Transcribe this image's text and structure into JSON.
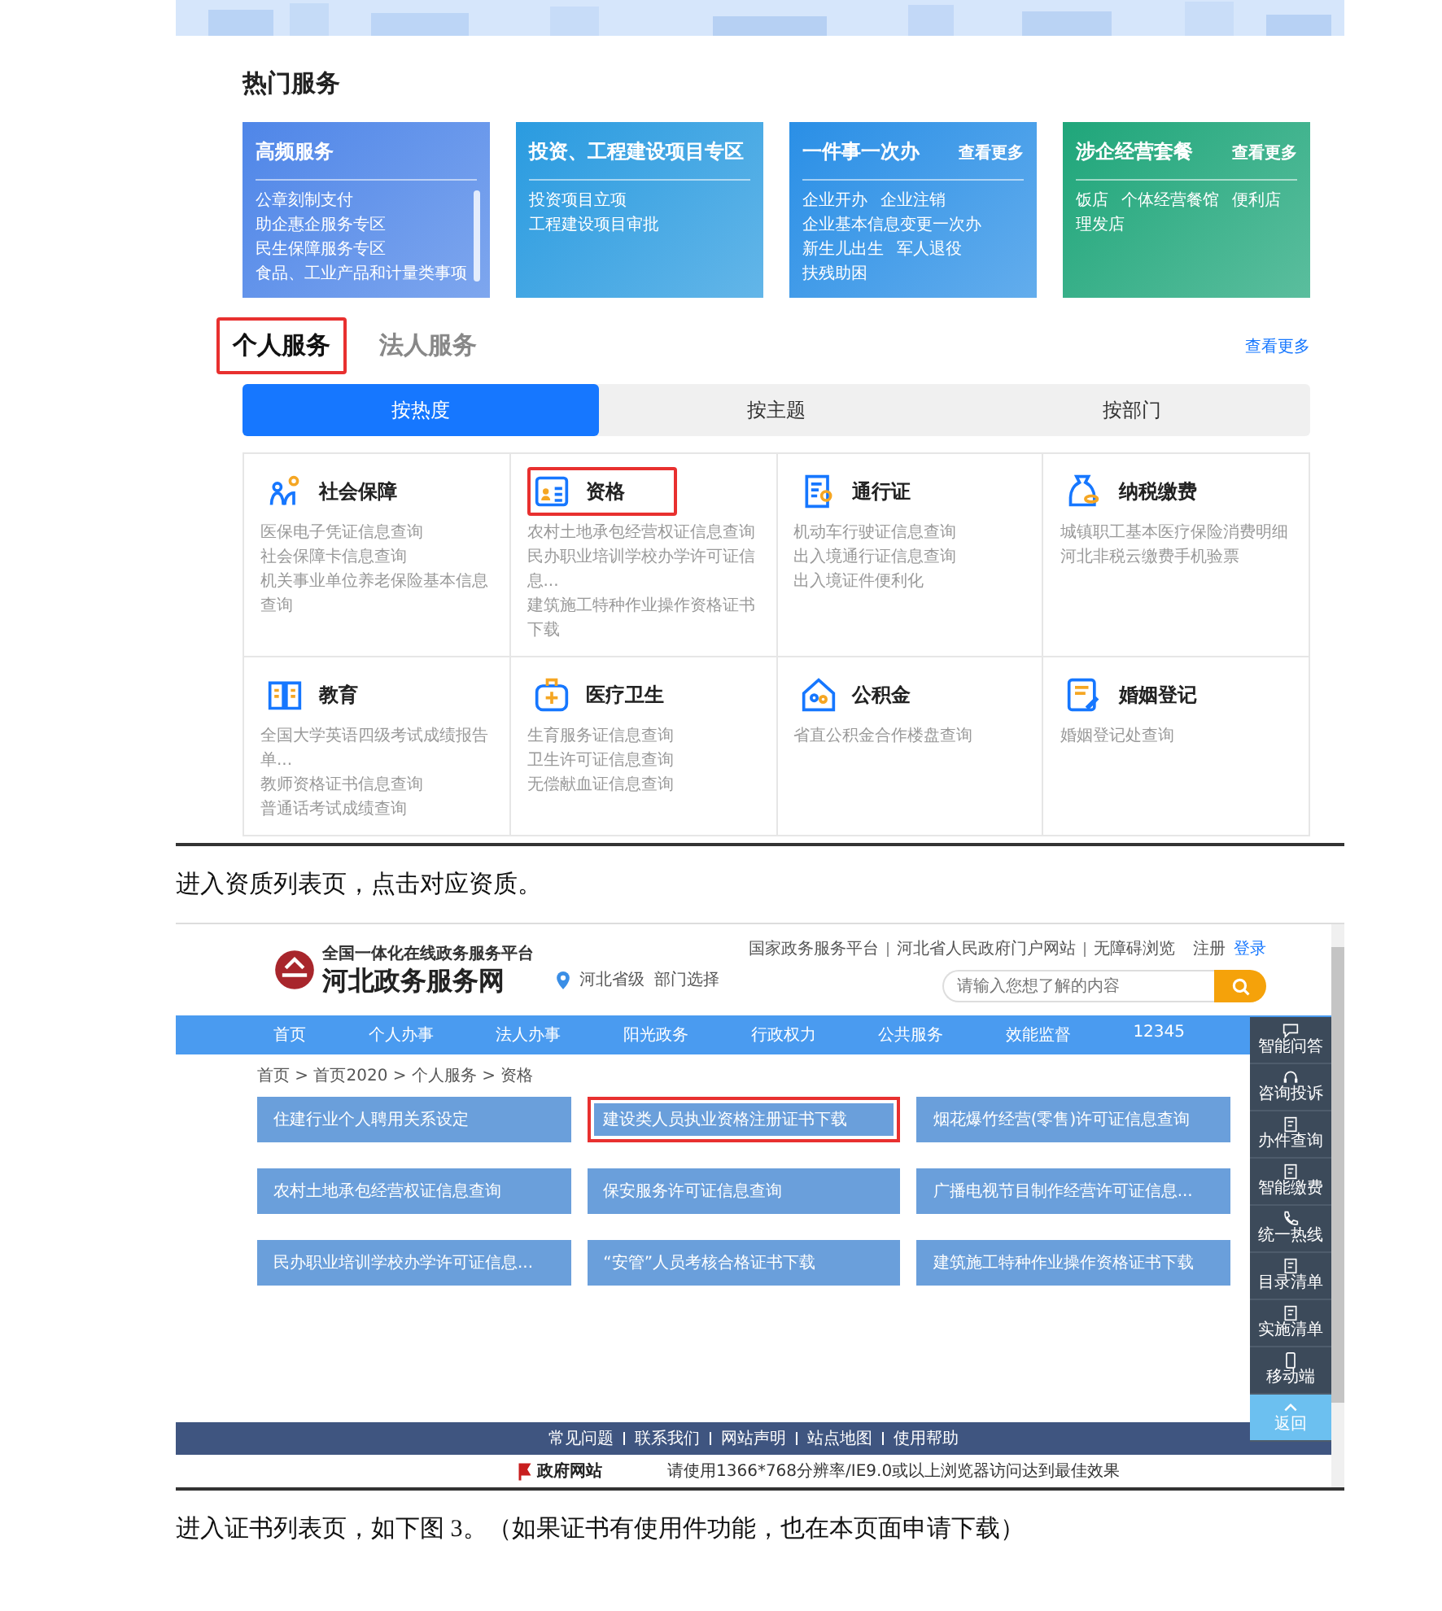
{
  "hot_services": {
    "title": "热门服务",
    "cards": [
      {
        "title": "高频服务",
        "color": "#4f86e8",
        "scroll": true,
        "lines": [
          [
            "公章刻制支付"
          ],
          [
            "助企惠企服务专区"
          ],
          [
            "民生保障服务专区"
          ],
          [
            "食品、工业产品和计量类事项"
          ]
        ]
      },
      {
        "title": "投资、工程建设项目专区",
        "color": "#2a9be0",
        "scroll": false,
        "lines": [
          [
            "投资项目立项"
          ],
          [
            "工程建设项目审批"
          ]
        ]
      },
      {
        "title": "一件事一次办",
        "more": "查看更多",
        "color": "#2a8fe6",
        "scroll": false,
        "lines": [
          [
            "企业开办",
            "企业注销"
          ],
          [
            "企业基本信息变更一次办"
          ],
          [
            "新生儿出生",
            "军人退役"
          ],
          [
            "扶残助困"
          ]
        ]
      },
      {
        "title": "涉企经营套餐",
        "more": "查看更多",
        "color": "#1fa67a",
        "scroll": false,
        "lines": [
          [
            "饭店",
            "个体经营餐馆",
            "便利店"
          ],
          [
            "理发店"
          ]
        ]
      }
    ]
  },
  "service_tabs": [
    {
      "label": "个人服务",
      "selected": true,
      "highlighted": true
    },
    {
      "label": "法人服务",
      "selected": false,
      "highlighted": false
    }
  ],
  "service_more": "查看更多",
  "sort_tabs": [
    {
      "label": "按热度",
      "selected": true
    },
    {
      "label": "按主题",
      "selected": false
    },
    {
      "label": "按部门",
      "selected": false
    }
  ],
  "categories": [
    {
      "title": "社会保障",
      "highlighted": false,
      "links": [
        "医保电子凭证信息查询",
        "社会保障卡信息查询",
        "机关事业单位养老保险基本信息查询"
      ]
    },
    {
      "title": "资格",
      "highlighted": true,
      "links": [
        "农村土地承包经营权证信息查询",
        "民办职业培训学校办学许可证信息...",
        "建筑施工特种作业操作资格证书下载"
      ]
    },
    {
      "title": "通行证",
      "highlighted": false,
      "links": [
        "机动车行驶证信息查询",
        "出入境通行证信息查询",
        "出入境证件便利化"
      ]
    },
    {
      "title": "纳税缴费",
      "highlighted": false,
      "links": [
        "城镇职工基本医疗保险消费明细",
        "河北非税云缴费手机验票"
      ]
    },
    {
      "title": "教育",
      "highlighted": false,
      "links": [
        "全国大学英语四级考试成绩报告单...",
        "教师资格证书信息查询",
        "普通话考试成绩查询"
      ]
    },
    {
      "title": "医疗卫生",
      "highlighted": false,
      "links": [
        "生育服务证信息查询",
        "卫生许可证信息查询",
        "无偿献血证信息查询"
      ]
    },
    {
      "title": "公积金",
      "highlighted": false,
      "links": [
        "省直公积金合作楼盘查询"
      ]
    },
    {
      "title": "婚姻登记",
      "highlighted": false,
      "links": [
        "婚姻登记处查询"
      ]
    }
  ],
  "paragraph_1": "进入资质列表页，点击对应资质。",
  "portal": {
    "logo_subtitle": "全国一体化在线政务服务平台",
    "logo_title": "河北政务服务网",
    "location": "河北省级",
    "department": "部门选择",
    "top_links": [
      "国家政务服务平台",
      "河北省人民政府门户网站",
      "无障碍浏览"
    ],
    "register": "注册",
    "login": "登录",
    "search_placeholder": "请输入您想了解的内容",
    "nav": [
      "首页",
      "个人办事",
      "法人办事",
      "阳光政务",
      "行政权力",
      "公共服务",
      "效能监督",
      "12345"
    ],
    "breadcrumb": "首页 > 首页2020 > 个人服务 > 资格",
    "buttons": [
      {
        "label": "住建行业个人聘用关系设定",
        "highlighted": false
      },
      {
        "label": "建设类人员执业资格注册证书下载",
        "highlighted": true
      },
      {
        "label": "烟花爆竹经营(零售)许可证信息查询",
        "highlighted": false
      },
      {
        "label": "农村土地承包经营权证信息查询",
        "highlighted": false
      },
      {
        "label": "保安服务许可证信息查询",
        "highlighted": false
      },
      {
        "label": "广播电视节目制作经营许可证信息...",
        "highlighted": false
      },
      {
        "label": "民办职业培训学校办学许可证信息...",
        "highlighted": false
      },
      {
        "label": "“安管”人员考核合格证书下载",
        "highlighted": false
      },
      {
        "label": "建筑施工特种作业操作资格证书下载",
        "highlighted": false
      }
    ],
    "sidebar": [
      {
        "label": "智能问答",
        "kind": "chat"
      },
      {
        "label": "咨询投诉",
        "kind": "headset"
      },
      {
        "label": "办件查询",
        "kind": "doc"
      },
      {
        "label": "智能缴费",
        "kind": "doc"
      },
      {
        "label": "统一热线",
        "kind": "phone"
      },
      {
        "label": "目录清单",
        "kind": "doc"
      },
      {
        "label": "实施清单",
        "kind": "doc"
      },
      {
        "label": "移动端",
        "kind": "mobile"
      },
      {
        "label": "返回",
        "kind": "top"
      }
    ],
    "footer_links": [
      "常见问题",
      "联系我们",
      "网站声明",
      "站点地图",
      "使用帮助"
    ],
    "footer_logo": "政府网站",
    "footer_note": "请使用1366*768分辨率/IE9.0或以上浏览器访问达到最佳效果"
  },
  "paragraph_2": "进入证书列表页，如下图 3。（如果证书有使用件功能，也在本页面申请下载）"
}
